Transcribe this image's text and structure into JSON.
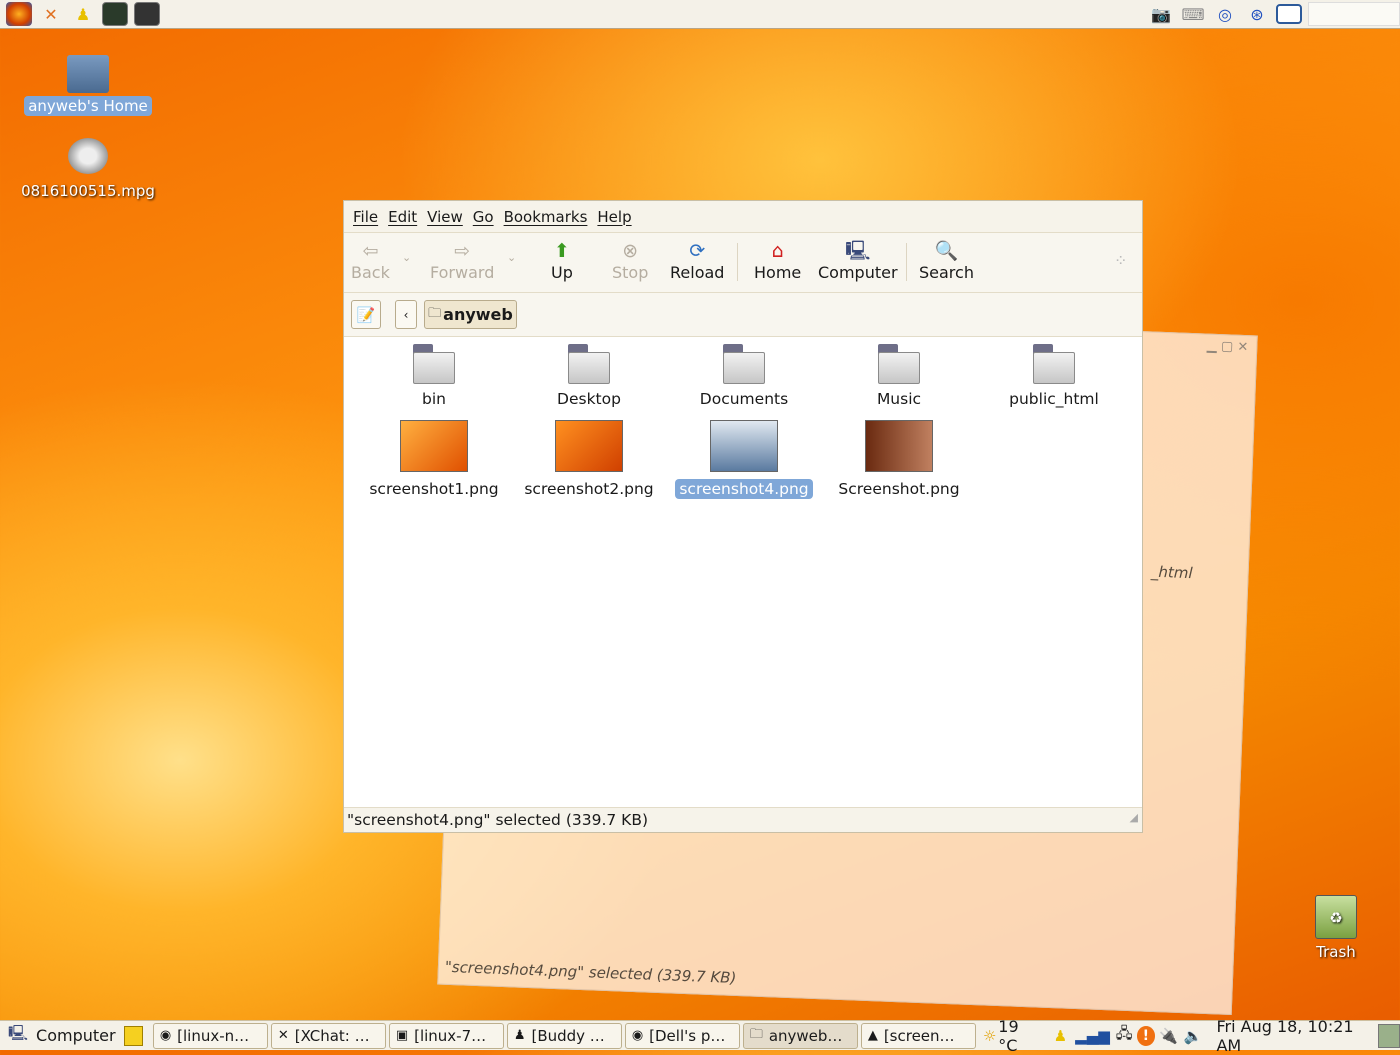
{
  "top_panel": {
    "launchers": [
      {
        "icon": "firefox-icon"
      },
      {
        "icon": "xchat-icon"
      },
      {
        "icon": "buddy-icon"
      },
      {
        "icon": "terminal-icon"
      },
      {
        "icon": "console-icon"
      }
    ],
    "tray": [
      {
        "icon": "camera-icon"
      },
      {
        "icon": "keyboard-icon"
      },
      {
        "icon": "wireless-icon"
      },
      {
        "icon": "network-icon"
      },
      {
        "icon": "workspace-icon"
      }
    ]
  },
  "desktop": {
    "icons": [
      {
        "label": "anyweb's Home",
        "icon": "home-folder-icon"
      },
      {
        "label": "0816100515.mpg",
        "icon": "video-icon"
      },
      {
        "label": "Trash",
        "icon": "trash-icon"
      }
    ]
  },
  "window": {
    "menu": [
      "File",
      "Edit",
      "View",
      "Go",
      "Bookmarks",
      "Help"
    ],
    "toolbar": {
      "back": "Back",
      "forward": "Forward",
      "up": "Up",
      "stop": "Stop",
      "reload": "Reload",
      "home": "Home",
      "computer": "Computer",
      "search": "Search"
    },
    "location": {
      "current": "anyweb"
    },
    "files": [
      {
        "name": "bin",
        "type": "folder"
      },
      {
        "name": "Desktop",
        "type": "folder"
      },
      {
        "name": "Documents",
        "type": "folder"
      },
      {
        "name": "Music",
        "type": "folder"
      },
      {
        "name": "public_html",
        "type": "folder"
      },
      {
        "name": "screenshot1.png",
        "type": "image"
      },
      {
        "name": "screenshot2.png",
        "type": "image"
      },
      {
        "name": "screenshot4.png",
        "type": "image",
        "selected": true
      },
      {
        "name": "Screenshot.png",
        "type": "image"
      }
    ],
    "status": "\"screenshot4.png\" selected (339.7 KB)"
  },
  "ghost_window": {
    "label": "_html",
    "status": "\"screenshot4.png\" selected (339.7 KB)"
  },
  "taskbar": {
    "show_desktop": "Computer",
    "tasks": [
      "[linux-n…",
      "[XChat: …",
      "[linux-7…",
      "[Buddy …",
      "[Dell's p…",
      "anyweb…",
      "[screen…"
    ],
    "weather": "19 °C",
    "clock": "Fri Aug 18, 10:21 AM"
  },
  "colors": {
    "selection": "#7fa7d8",
    "panel": "#f4f1e8"
  }
}
